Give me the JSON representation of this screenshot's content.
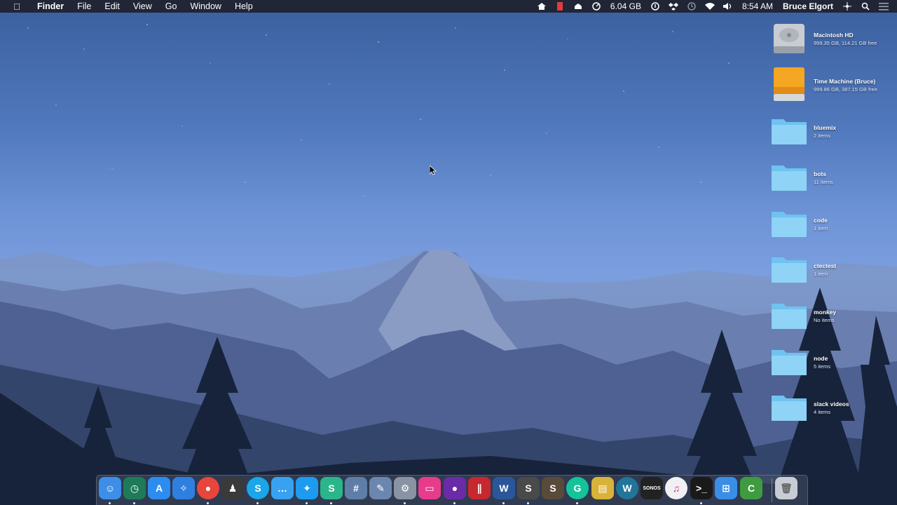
{
  "menubar": {
    "apple_icon": "apple-icon",
    "app_name": "Finder",
    "menus": [
      "File",
      "Edit",
      "View",
      "Go",
      "Window",
      "Help"
    ],
    "memory": "6.04 GB",
    "time": "8:54 AM",
    "user": "Bruce Elgort",
    "status_icons": [
      "house-icon",
      "battery-red-icon",
      "cloud-upload-icon",
      "memory-gauge-icon",
      "info-icon",
      "dropbox-icon",
      "time-machine-icon",
      "wifi-icon",
      "volume-icon",
      "sharing-icon",
      "spotlight-icon",
      "notification-center-icon"
    ]
  },
  "desktop": {
    "items": [
      {
        "name": "Macintosh HD",
        "info": "999.35 GB, 114.21 GB free",
        "icon": "hard-drive-icon"
      },
      {
        "name": "Time Machine (Bruce)",
        "info": "999.86 GB, 387.15 GB free",
        "icon": "external-drive-icon"
      },
      {
        "name": "bluemix",
        "info": "2 items",
        "icon": "folder-icon"
      },
      {
        "name": "bots",
        "info": "11 items",
        "icon": "folder-icon"
      },
      {
        "name": "code",
        "info": "1 item",
        "icon": "folder-icon"
      },
      {
        "name": "ctectest",
        "info": "1 item",
        "icon": "folder-icon"
      },
      {
        "name": "monkey",
        "info": "No items",
        "icon": "folder-icon"
      },
      {
        "name": "node",
        "info": "5 items",
        "icon": "folder-icon"
      },
      {
        "name": "slack videos",
        "info": "4 items",
        "icon": "folder-icon"
      }
    ]
  },
  "dock": {
    "apps": [
      {
        "icon": "finder-icon",
        "glyph": "☺",
        "color": "#3d8ee8"
      },
      {
        "icon": "time-machine-app-icon",
        "glyph": "◷",
        "color": "#1f7a5a"
      },
      {
        "icon": "app-store-icon",
        "glyph": "A",
        "color": "#2d8cf0"
      },
      {
        "icon": "safari-icon",
        "glyph": "✧",
        "color": "#2f7fe0"
      },
      {
        "icon": "chrome-icon",
        "glyph": "●",
        "color": "#e8453c"
      },
      {
        "icon": "hooded-figure-icon",
        "glyph": "♟",
        "color": "#3a3a3a"
      },
      {
        "icon": "skype-icon",
        "glyph": "S",
        "color": "#1aa6e8"
      },
      {
        "icon": "messages-icon",
        "glyph": "…",
        "color": "#38a2f0"
      },
      {
        "icon": "twitter-icon",
        "glyph": "✦",
        "color": "#1d9bf0"
      },
      {
        "icon": "slack-icon",
        "glyph": "S",
        "color": "#2bb58a"
      },
      {
        "icon": "grid-app-icon",
        "glyph": "#",
        "color": "#5e7ea8"
      },
      {
        "icon": "preview-icon",
        "glyph": "✎",
        "color": "#6b87b0"
      },
      {
        "icon": "system-preferences-icon",
        "glyph": "⚙",
        "color": "#8a93a3"
      },
      {
        "icon": "monitor-app-icon",
        "glyph": "▭",
        "color": "#e83b8c"
      },
      {
        "icon": "github-icon",
        "glyph": "●",
        "color": "#6b2ba8"
      },
      {
        "icon": "parallels-icon",
        "glyph": "∥",
        "color": "#c7282f"
      },
      {
        "icon": "word-icon",
        "glyph": "W",
        "color": "#2b579a"
      },
      {
        "icon": "sublime-text-icon",
        "glyph": "S",
        "color": "#4a4a4a"
      },
      {
        "icon": "sublime-text-2-icon",
        "glyph": "S",
        "color": "#5a4a3a"
      },
      {
        "icon": "grammarly-icon",
        "glyph": "G",
        "color": "#15c39a"
      },
      {
        "icon": "archive-utility-icon",
        "glyph": "▤",
        "color": "#d9b23a"
      },
      {
        "icon": "wordpress-icon",
        "glyph": "W",
        "color": "#21759b"
      },
      {
        "icon": "sonos-icon",
        "glyph": "SONOS",
        "color": "#222222"
      },
      {
        "icon": "itunes-icon",
        "glyph": "♫",
        "color": "#f0f0f5"
      },
      {
        "icon": "terminal-icon",
        "glyph": ">_",
        "color": "#1a1a1a"
      },
      {
        "icon": "windows-icon",
        "glyph": "⊞",
        "color": "#3a8ee6"
      },
      {
        "icon": "camtasia-icon",
        "glyph": "C",
        "color": "#3f9b3f"
      },
      {
        "icon": "trash-icon",
        "glyph": "🗑",
        "color": "#c8ccd4"
      }
    ]
  }
}
